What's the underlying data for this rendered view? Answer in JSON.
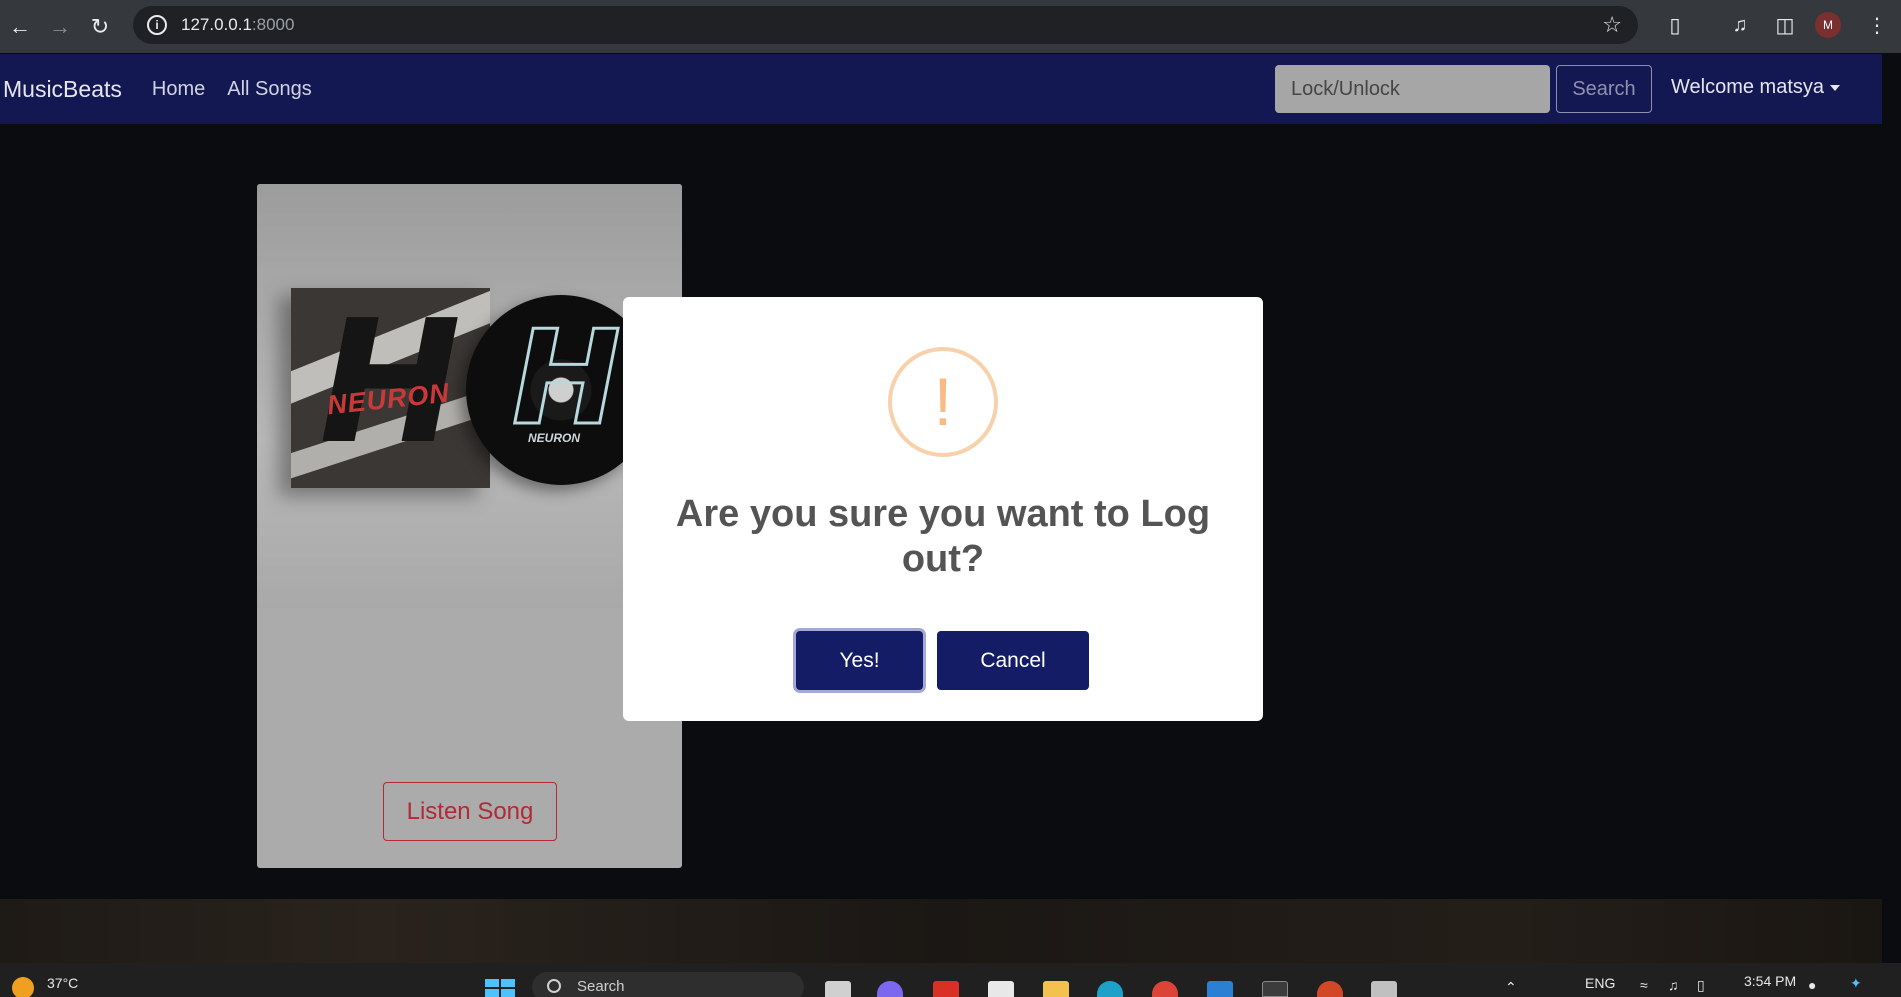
{
  "browser": {
    "url_host": "127.0.0.1",
    "url_port": ":8000",
    "profile_initial": "M"
  },
  "navbar": {
    "brand": "MusicBeats",
    "links": [
      "Home",
      "All Songs"
    ],
    "search_placeholder": "Lock/Unlock",
    "search_button": "Search",
    "user_menu": "Welcome matsya"
  },
  "card": {
    "album_text": "NEURON",
    "disc_text": "NEURON",
    "button": "Listen Song"
  },
  "modal": {
    "icon": "!",
    "title": "Are you sure you want to Log out?",
    "confirm_button": "Yes!",
    "cancel_button": "Cancel"
  },
  "taskbar": {
    "temperature": "37°C",
    "search": "Search",
    "language": "ENG",
    "time": "3:54 PM"
  },
  "colors": {
    "navbar_bg": "#141852",
    "modal_button_bg": "#141c66",
    "warning_icon": "#f8bb86",
    "listen_button": "#b02a37"
  }
}
